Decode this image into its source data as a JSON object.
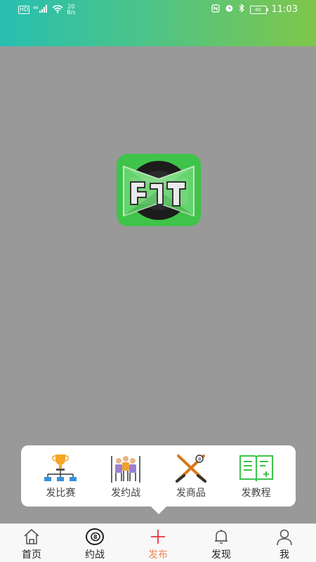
{
  "status_bar": {
    "hd": "HD",
    "signal": "4G",
    "net_speed_value": "20",
    "net_speed_unit": "B/s",
    "battery": "45",
    "time": "11:03"
  },
  "publish_menu": {
    "items": [
      {
        "label": "发比赛",
        "icon": "trophy-bracket-icon"
      },
      {
        "label": "发约战",
        "icon": "players-icon"
      },
      {
        "label": "发商品",
        "icon": "crossed-cues-icon"
      },
      {
        "label": "发教程",
        "icon": "book-icon"
      }
    ]
  },
  "tab_bar": {
    "items": [
      {
        "label": "首页",
        "icon": "home-icon"
      },
      {
        "label": "约战",
        "icon": "eight-ball-icon"
      },
      {
        "label": "发布",
        "icon": "plus-icon",
        "active": true
      },
      {
        "label": "发现",
        "icon": "bell-icon"
      },
      {
        "label": "我",
        "icon": "person-icon"
      }
    ]
  },
  "colors": {
    "accent": "#f08a5d",
    "logo_green": "#3fc34a",
    "overlay": "#999999"
  }
}
